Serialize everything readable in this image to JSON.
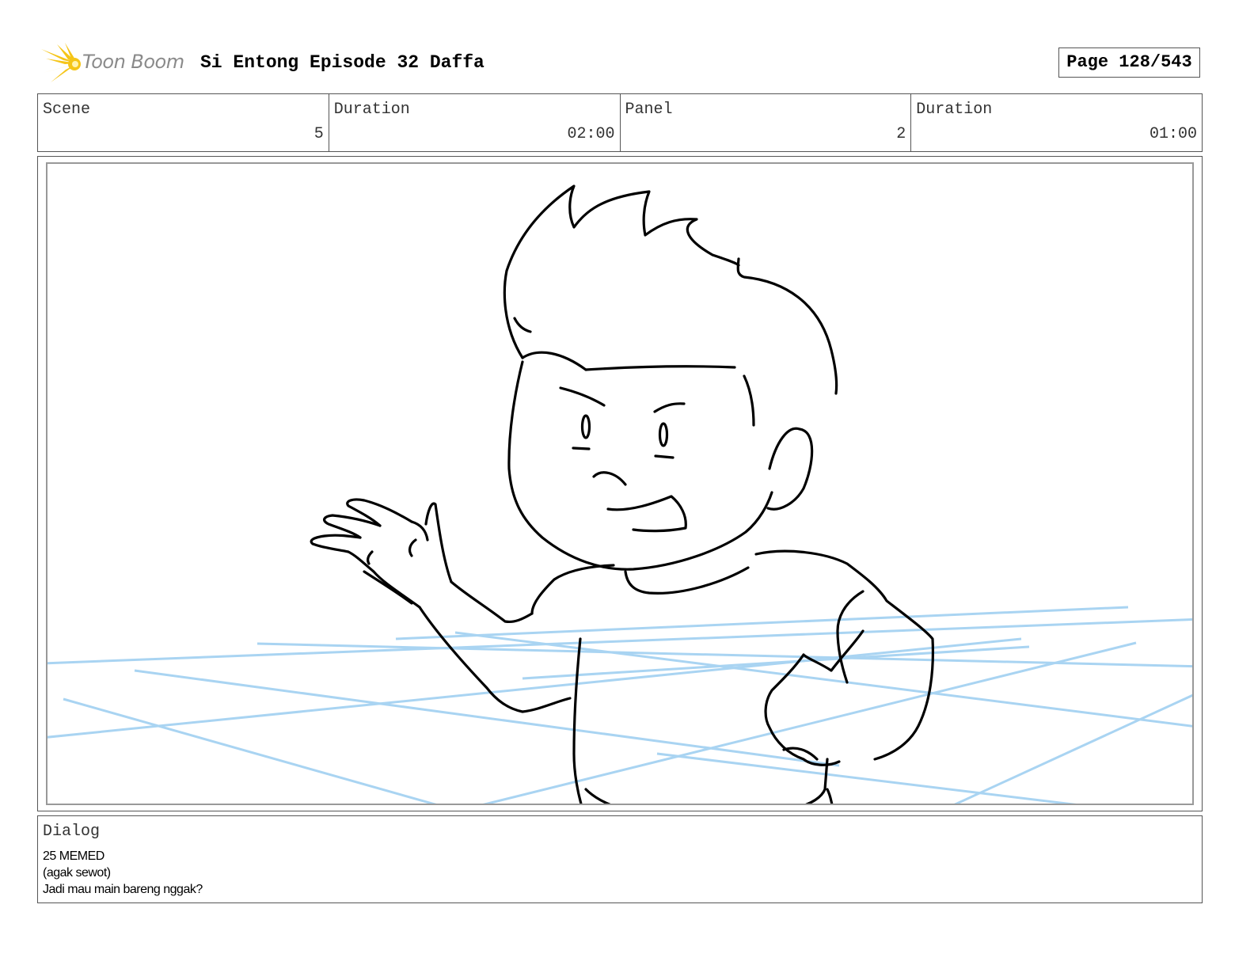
{
  "header": {
    "logo_text": "Toon Boom",
    "title": "Si Entong Episode 32 Daffa",
    "page": "Page 128/543"
  },
  "info": {
    "scene_label": "Scene",
    "scene_value": "5",
    "scene_duration_label": "Duration",
    "scene_duration_value": "02:00",
    "panel_label": "Panel",
    "panel_value": "2",
    "panel_duration_label": "Duration",
    "panel_duration_value": "01:00"
  },
  "dialog": {
    "label": "Dialog",
    "lines": [
      "25 MEMED",
      "(agak sewot)",
      "Jadi mau main bareng nggak?"
    ]
  },
  "colors": {
    "logo_flare": "#f5c518",
    "guide_lines": "#a9d4f2",
    "sketch": "#000000"
  }
}
